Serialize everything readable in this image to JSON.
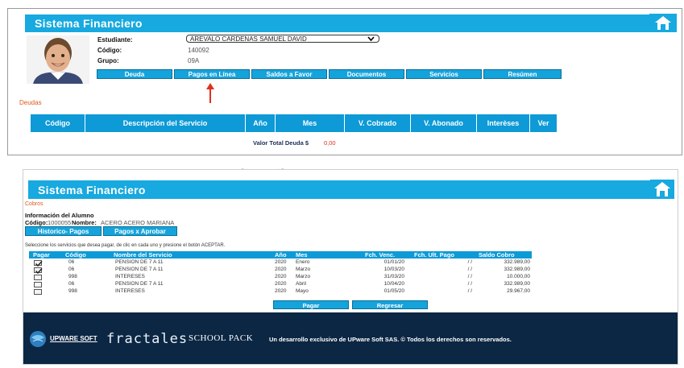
{
  "top": {
    "title": "Sistema Financiero",
    "student": {
      "label_estudiante": "Estudiante:",
      "estudiante_value": "AREVALO CARDENAS SAMUEL DAVID",
      "label_codigo": "Código:",
      "codigo_value": "140092",
      "label_grupo": "Grupo:",
      "grupo_value": "09A"
    },
    "nav": [
      "Deuda",
      "Pagos en Línea",
      "Saldos a Favor",
      "Documentos",
      "Servicios",
      "Resúmen"
    ],
    "section_label": "Deudas",
    "table_headers": [
      "Código",
      "Descripción del Servicio",
      "Año",
      "Mes",
      "V. Cobrado",
      "V. Abonado",
      "Interèses",
      "Ver"
    ],
    "total_label": "Valor Total Deuda $",
    "total_value": "0,00"
  },
  "bottom": {
    "title": "Sistema Financiero",
    "section_label": "Cobros",
    "info_heading": "Información del Alumno",
    "codigo_label": "Código:",
    "codigo_value": "1000055",
    "nombre_label": "Nombre:",
    "nombre_value": "ACERO ACERO MARIANA",
    "tab_historico": "Historico- Pagos",
    "tab_pagos_aprobar": "Pagos x Aprobar",
    "instruction": "Seleccione los servicios que desea pagar, de clic en cada uno y presione el botón ACEPTAR.",
    "headers": [
      "Pagar",
      "Código",
      "Nombre del Servicio",
      "Año",
      "Mes",
      "Fch. Venc.",
      "Fch. Ult. Pago",
      "Saldo Cobro"
    ],
    "rows": [
      {
        "checked": true,
        "codigo": "06",
        "nombre": "PENSION DE 7 A 11",
        "anio": "2020",
        "mes": "Enero",
        "venc": "01/01/20",
        "ult": "/ /",
        "saldo": "332.989,00"
      },
      {
        "checked": true,
        "codigo": "06",
        "nombre": "PENSION DE 7 A 11",
        "anio": "2020",
        "mes": "Marzo",
        "venc": "10/03/20",
        "ult": "/ /",
        "saldo": "332.989,00"
      },
      {
        "checked": false,
        "codigo": "998",
        "nombre": "INTERESES",
        "anio": "2020",
        "mes": "Marzo",
        "venc": "31/03/20",
        "ult": "/ /",
        "saldo": "10.000,00"
      },
      {
        "checked": false,
        "codigo": "06",
        "nombre": "PENSION DE 7 A 11",
        "anio": "2020",
        "mes": "Abril",
        "venc": "10/04/20",
        "ult": "/ /",
        "saldo": "332.989,00"
      },
      {
        "checked": false,
        "codigo": "998",
        "nombre": "INTERESES",
        "anio": "2020",
        "mes": "Mayo",
        "venc": "01/05/20",
        "ult": "/ /",
        "saldo": "29.967,00"
      }
    ],
    "btn_pagar": "Pagar",
    "btn_regresar": "Regresar",
    "footer": {
      "brand_upware": "UPWARE SOFT",
      "brand_fractales": "fractales",
      "brand_schoolpack": "SCHOOL PACK",
      "text": "Un desarrollo exclusivo de UPware Soft SAS. © Todos los derechos son reservados."
    }
  },
  "colors": {
    "accent": "#17a9df",
    "header_blue": "#0d9ad6",
    "red": "#e0301e",
    "footer_bg": "#0c2744"
  },
  "icons": [
    "home-icon",
    "red-up-arrow-icon",
    "dropdown-chevron-icon",
    "checkbox-icon",
    "globe-logo-icon"
  ]
}
